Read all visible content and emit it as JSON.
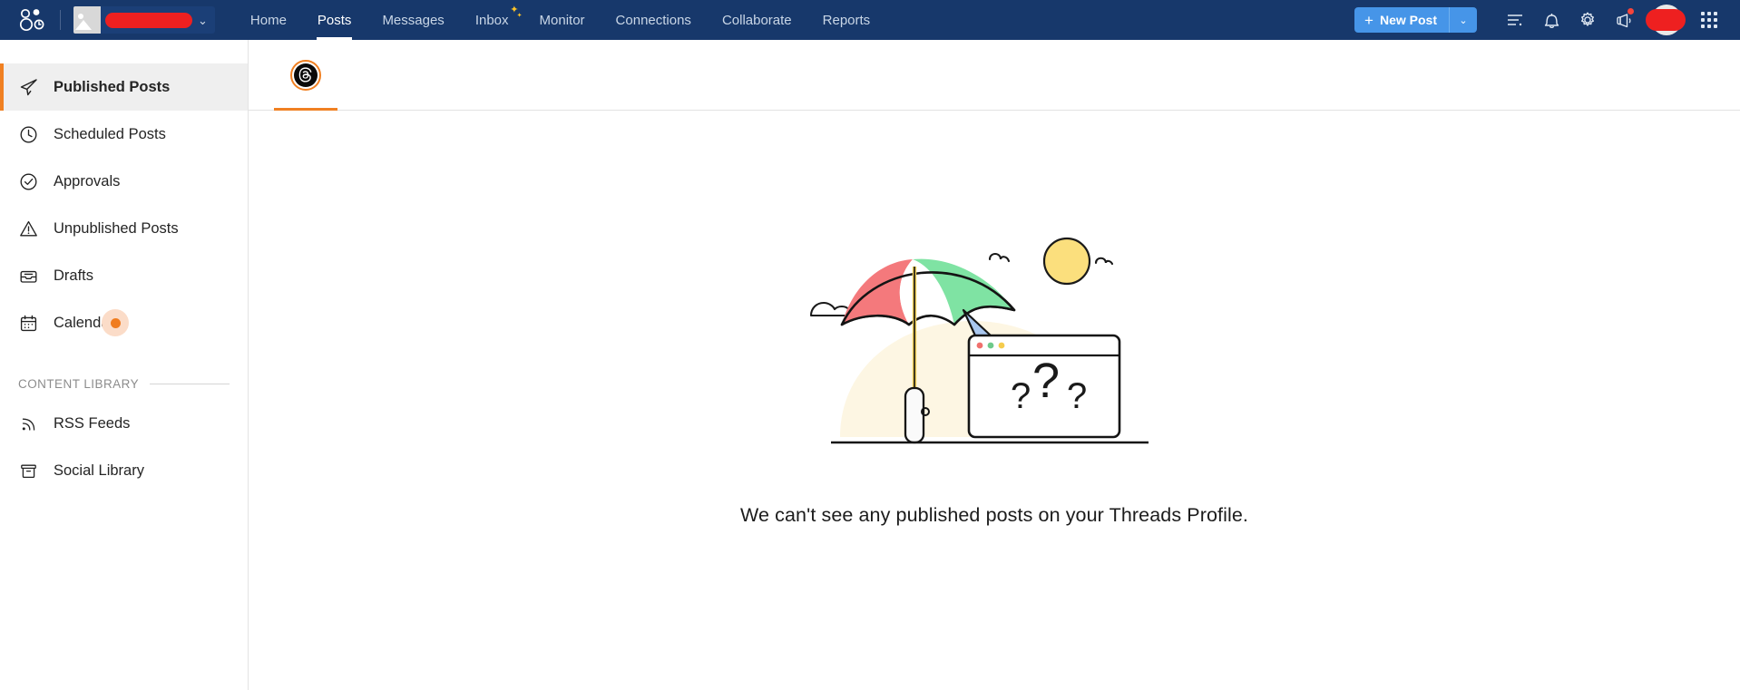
{
  "topnav": {
    "brand_icon": "sprout-social-logo-icon",
    "profile": {
      "name_redacted": "",
      "caret": "⌄",
      "thumb_icon": "image-placeholder-icon"
    },
    "links": [
      {
        "label": "Home",
        "active": false,
        "sparkle": false
      },
      {
        "label": "Posts",
        "active": true,
        "sparkle": false
      },
      {
        "label": "Messages",
        "active": false,
        "sparkle": false
      },
      {
        "label": "Inbox",
        "active": false,
        "sparkle": true
      },
      {
        "label": "Monitor",
        "active": false,
        "sparkle": false
      },
      {
        "label": "Connections",
        "active": false,
        "sparkle": false
      },
      {
        "label": "Collaborate",
        "active": false,
        "sparkle": false
      },
      {
        "label": "Reports",
        "active": false,
        "sparkle": false
      }
    ],
    "new_post": {
      "label": "New Post",
      "plus": "+",
      "caret": "⌄"
    },
    "icons": [
      {
        "name": "tasks-list-icon",
        "badge": false
      },
      {
        "name": "notifications-bell-icon",
        "badge": false
      },
      {
        "name": "settings-gear-icon",
        "badge": false
      },
      {
        "name": "megaphone-announcements-icon",
        "badge": true
      }
    ],
    "apps_grid_icon": "apps-grid-icon",
    "colors": {
      "nav_bg": "#17386b",
      "new_post_bg": "#4695e8",
      "badge": "#f5443b",
      "redact": "#ee2020"
    }
  },
  "sidebar": {
    "items": [
      {
        "label": "Published Posts",
        "icon": "paper-plane-icon",
        "active": true,
        "dot": false
      },
      {
        "label": "Scheduled Posts",
        "icon": "clock-icon",
        "active": false,
        "dot": false
      },
      {
        "label": "Approvals",
        "icon": "check-circle-icon",
        "active": false,
        "dot": false
      },
      {
        "label": "Unpublished Posts",
        "icon": "warning-triangle-icon",
        "active": false,
        "dot": false
      },
      {
        "label": "Drafts",
        "icon": "drafts-tray-icon",
        "active": false,
        "dot": false
      },
      {
        "label": "Calendar",
        "icon": "calendar-icon",
        "active": false,
        "dot": true
      }
    ],
    "section_title": "CONTENT LIBRARY",
    "library_items": [
      {
        "label": "RSS Feeds",
        "icon": "rss-feed-icon"
      },
      {
        "label": "Social Library",
        "icon": "archive-box-icon"
      }
    ],
    "accent_color": "#f08022",
    "active_bg": "#efefef"
  },
  "main": {
    "tabs": [
      {
        "name": "threads-profile-tab",
        "icon": "threads-logo-icon",
        "active": true
      }
    ],
    "empty_state": {
      "illustration": "umbrella-sun-browser-question-marks-illustration",
      "message": "We can't see any published posts on your Threads Profile."
    },
    "accent_color": "#f08022"
  }
}
